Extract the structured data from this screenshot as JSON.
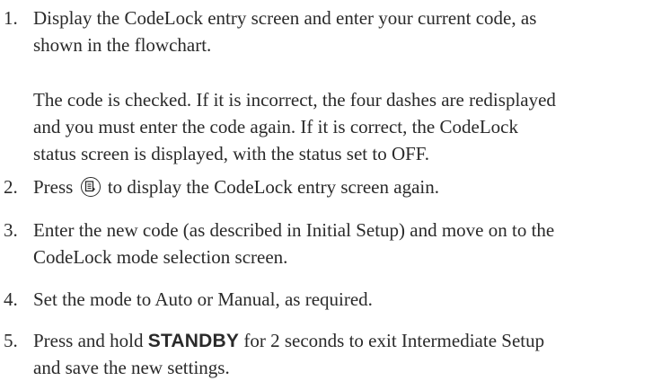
{
  "steps": [
    {
      "number": "1.",
      "line1": "Display the CodeLock entry screen and enter your current code, as",
      "line2": "shown in the flowchart.",
      "note_lines": [
        "The code is checked. If it is incorrect, the four dashes are redisplayed",
        "and you must enter the code again. If it is correct, the CodeLock",
        "status screen is displayed, with the status set to OFF."
      ]
    },
    {
      "number": "2.",
      "prefix": "Press",
      "icon": "menu-button-icon",
      "suffix": "to display the CodeLock entry screen again."
    },
    {
      "number": "3.",
      "line1": "Enter the new code (as described in Initial Setup) and move on to the",
      "line2": "CodeLock mode selection screen."
    },
    {
      "number": "4.",
      "line1": "Set the mode to Auto or Manual, as required."
    },
    {
      "number": "5.",
      "prefix": "Press and hold",
      "key": "STANDBY",
      "suffix": "for 2 seconds to exit Intermediate Setup",
      "line2": "and save the new settings."
    }
  ]
}
